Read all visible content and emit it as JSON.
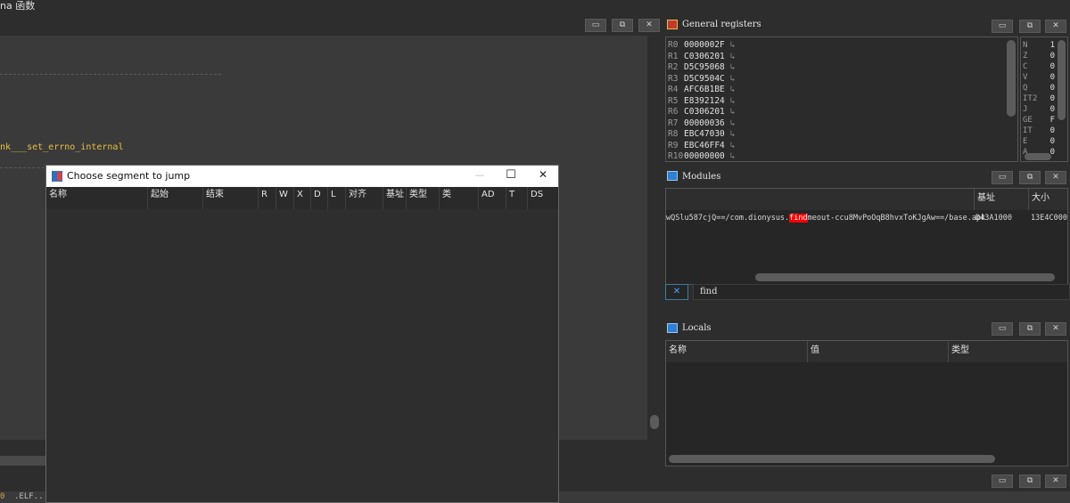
{
  "top": {
    "title": "na 函数"
  },
  "main": {
    "code_line": "nk___set_errno_internal",
    "status_text": ".ELF..",
    "status_prefix": "0"
  },
  "registers": {
    "title": "General registers",
    "rows": [
      {
        "name": "R0",
        "value": "0000002F"
      },
      {
        "name": "R1",
        "value": "C0306201"
      },
      {
        "name": "R2",
        "value": "D5C95068"
      },
      {
        "name": "R3",
        "value": "D5C9504C"
      },
      {
        "name": "R4",
        "value": "AFC6B1BE"
      },
      {
        "name": "R5",
        "value": "E8392124"
      },
      {
        "name": "R6",
        "value": "C0306201"
      },
      {
        "name": "R7",
        "value": "00000036"
      },
      {
        "name": "R8",
        "value": "EBC47030"
      },
      {
        "name": "R9",
        "value": "EBC46FF4"
      },
      {
        "name": "R10",
        "value": "00000000"
      }
    ],
    "arrow": "↳",
    "flags": [
      {
        "name": "N",
        "value": "1"
      },
      {
        "name": "Z",
        "value": "0"
      },
      {
        "name": "C",
        "value": "0"
      },
      {
        "name": "V",
        "value": "0"
      },
      {
        "name": "Q",
        "value": "0"
      },
      {
        "name": "IT2",
        "value": "0"
      },
      {
        "name": "J",
        "value": "0"
      },
      {
        "name": "GE",
        "value": "F"
      },
      {
        "name": "IT",
        "value": "0"
      },
      {
        "name": "E",
        "value": "0"
      },
      {
        "name": "A",
        "value": "0"
      }
    ]
  },
  "modules": {
    "title": "Modules",
    "columns": {
      "path": "",
      "base": "基址",
      "size": "大小"
    },
    "row": {
      "path_before": "wQSlu587cjQ==/com.dionysus.",
      "path_highlight": "find",
      "path_after": "meout-ccu8MvPoOqB8hvxToKJgAw==/base.apk",
      "base": "D43A1000",
      "size": "13E4C000"
    },
    "filter": {
      "clear_icon": "✕",
      "value": "find"
    }
  },
  "locals": {
    "title": "Locals",
    "columns": {
      "name": "名称",
      "value": "值",
      "type": "类型"
    }
  },
  "window_buttons": {
    "minimize": "▭",
    "restore": "⧉",
    "close": "✕"
  },
  "dialog": {
    "title": "Choose segment to jump",
    "minimize": "—",
    "maximize": "☐",
    "close": "✕",
    "columns": [
      "名称",
      "起始",
      "结束",
      "R",
      "W",
      "X",
      "D",
      "L",
      "对齐",
      "基址",
      "类型",
      "类",
      "AD",
      "T",
      "DS"
    ]
  },
  "colors": {
    "highlight": "#ff0000",
    "code_name": "#e5c046",
    "accent": "#2f7fd3"
  }
}
